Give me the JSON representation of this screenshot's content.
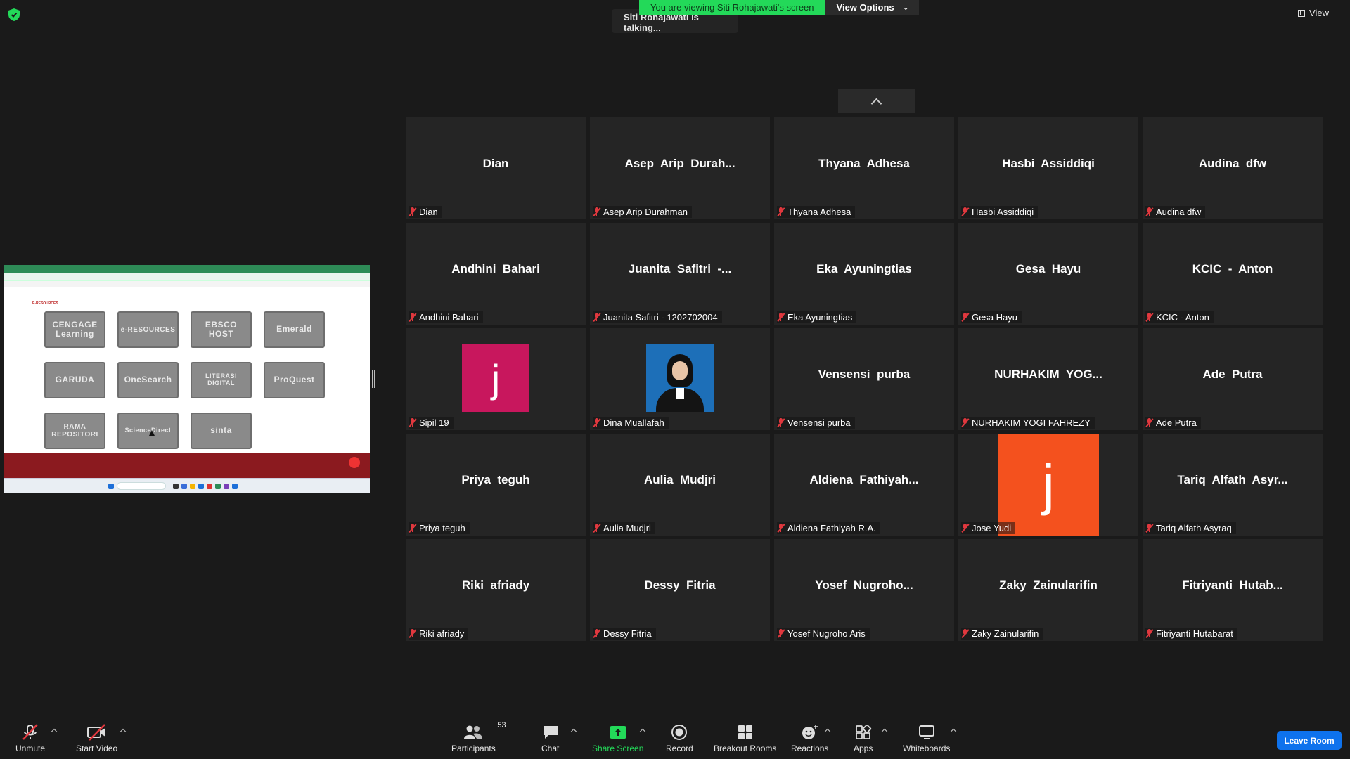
{
  "banner": {
    "viewing_text": "You are viewing Siti Rohajawati's screen",
    "view_options_label": "View Options",
    "talking_text": "Siti Rohajawati is talking..."
  },
  "top_right": {
    "view_label": "View"
  },
  "shared_screen": {
    "heading": "E-RESOURCES",
    "tiles": [
      "CENGAGE Learning",
      "e-RESOURCES",
      "EBSCO HOST",
      "Emerald",
      "GARUDA",
      "OneSearch",
      "LITERASI DIGITAL",
      "ProQuest",
      "RAMA REPOSITORI",
      "ScienceDirect",
      "sinta"
    ]
  },
  "gallery": {
    "tiles": [
      {
        "display": "Dian",
        "label": "Dian"
      },
      {
        "display": "Asep  Arip  Durah...",
        "label": "Asep Arip Durahman"
      },
      {
        "display": "Thyana  Adhesa",
        "label": "Thyana Adhesa"
      },
      {
        "display": "Hasbi  Assiddiqi",
        "label": "Hasbi Assiddiqi"
      },
      {
        "display": "Audina  dfw",
        "label": "Audina dfw"
      },
      {
        "display": "Andhini  Bahari",
        "label": "Andhini Bahari"
      },
      {
        "display": "Juanita  Safitri  -...",
        "label": "Juanita Safitri - 1202702004"
      },
      {
        "display": "Eka  Ayuningtias",
        "label": "Eka Ayuningtias"
      },
      {
        "display": "Gesa  Hayu",
        "label": "Gesa Hayu"
      },
      {
        "display": "KCIC  -  Anton",
        "label": "KCIC - Anton"
      },
      {
        "display": "",
        "label": "Sipil 19",
        "avatar": "j",
        "avatar_color": "#c8175d"
      },
      {
        "display": "",
        "label": "Dina Muallafah",
        "photo": true
      },
      {
        "display": "Vensensi  purba",
        "label": "Vensensi purba"
      },
      {
        "display": "NURHAKIM  YOG...",
        "label": "NURHAKIM YOGI FAHREZY"
      },
      {
        "display": "Ade  Putra",
        "label": "Ade Putra"
      },
      {
        "display": "Priya  teguh",
        "label": "Priya teguh"
      },
      {
        "display": "Aulia  Mudjri",
        "label": "Aulia Mudjri"
      },
      {
        "display": "Aldiena  Fathiyah...",
        "label": "Aldiena Fathiyah R.A."
      },
      {
        "display": "",
        "label": "Jose Yudi",
        "avatar": "j",
        "avatar_color": "#f4511e",
        "avatar_large": true
      },
      {
        "display": "Tariq  Alfath  Asyr...",
        "label": "Tariq Alfath Asyraq"
      },
      {
        "display": "Riki  afriady",
        "label": "Riki afriady"
      },
      {
        "display": "Dessy  Fitria",
        "label": "Dessy Fitria"
      },
      {
        "display": "Yosef  Nugroho...",
        "label": "Yosef Nugroho Aris"
      },
      {
        "display": "Zaky  Zainularifin",
        "label": "Zaky Zainularifin"
      },
      {
        "display": "Fitriyanti  Hutab...",
        "label": "Fitriyanti Hutabarat"
      }
    ]
  },
  "toolbar": {
    "unmute": "Unmute",
    "start_video": "Start Video",
    "participants": "Participants",
    "participants_count": "53",
    "chat": "Chat",
    "share_screen": "Share Screen",
    "record": "Record",
    "breakout_rooms": "Breakout Rooms",
    "reactions": "Reactions",
    "apps": "Apps",
    "whiteboards": "Whiteboards",
    "leave": "Leave Room"
  },
  "colors": {
    "accent_green": "#23d959",
    "leave_blue": "#0e72ed",
    "muted_red": "#e0383e"
  }
}
